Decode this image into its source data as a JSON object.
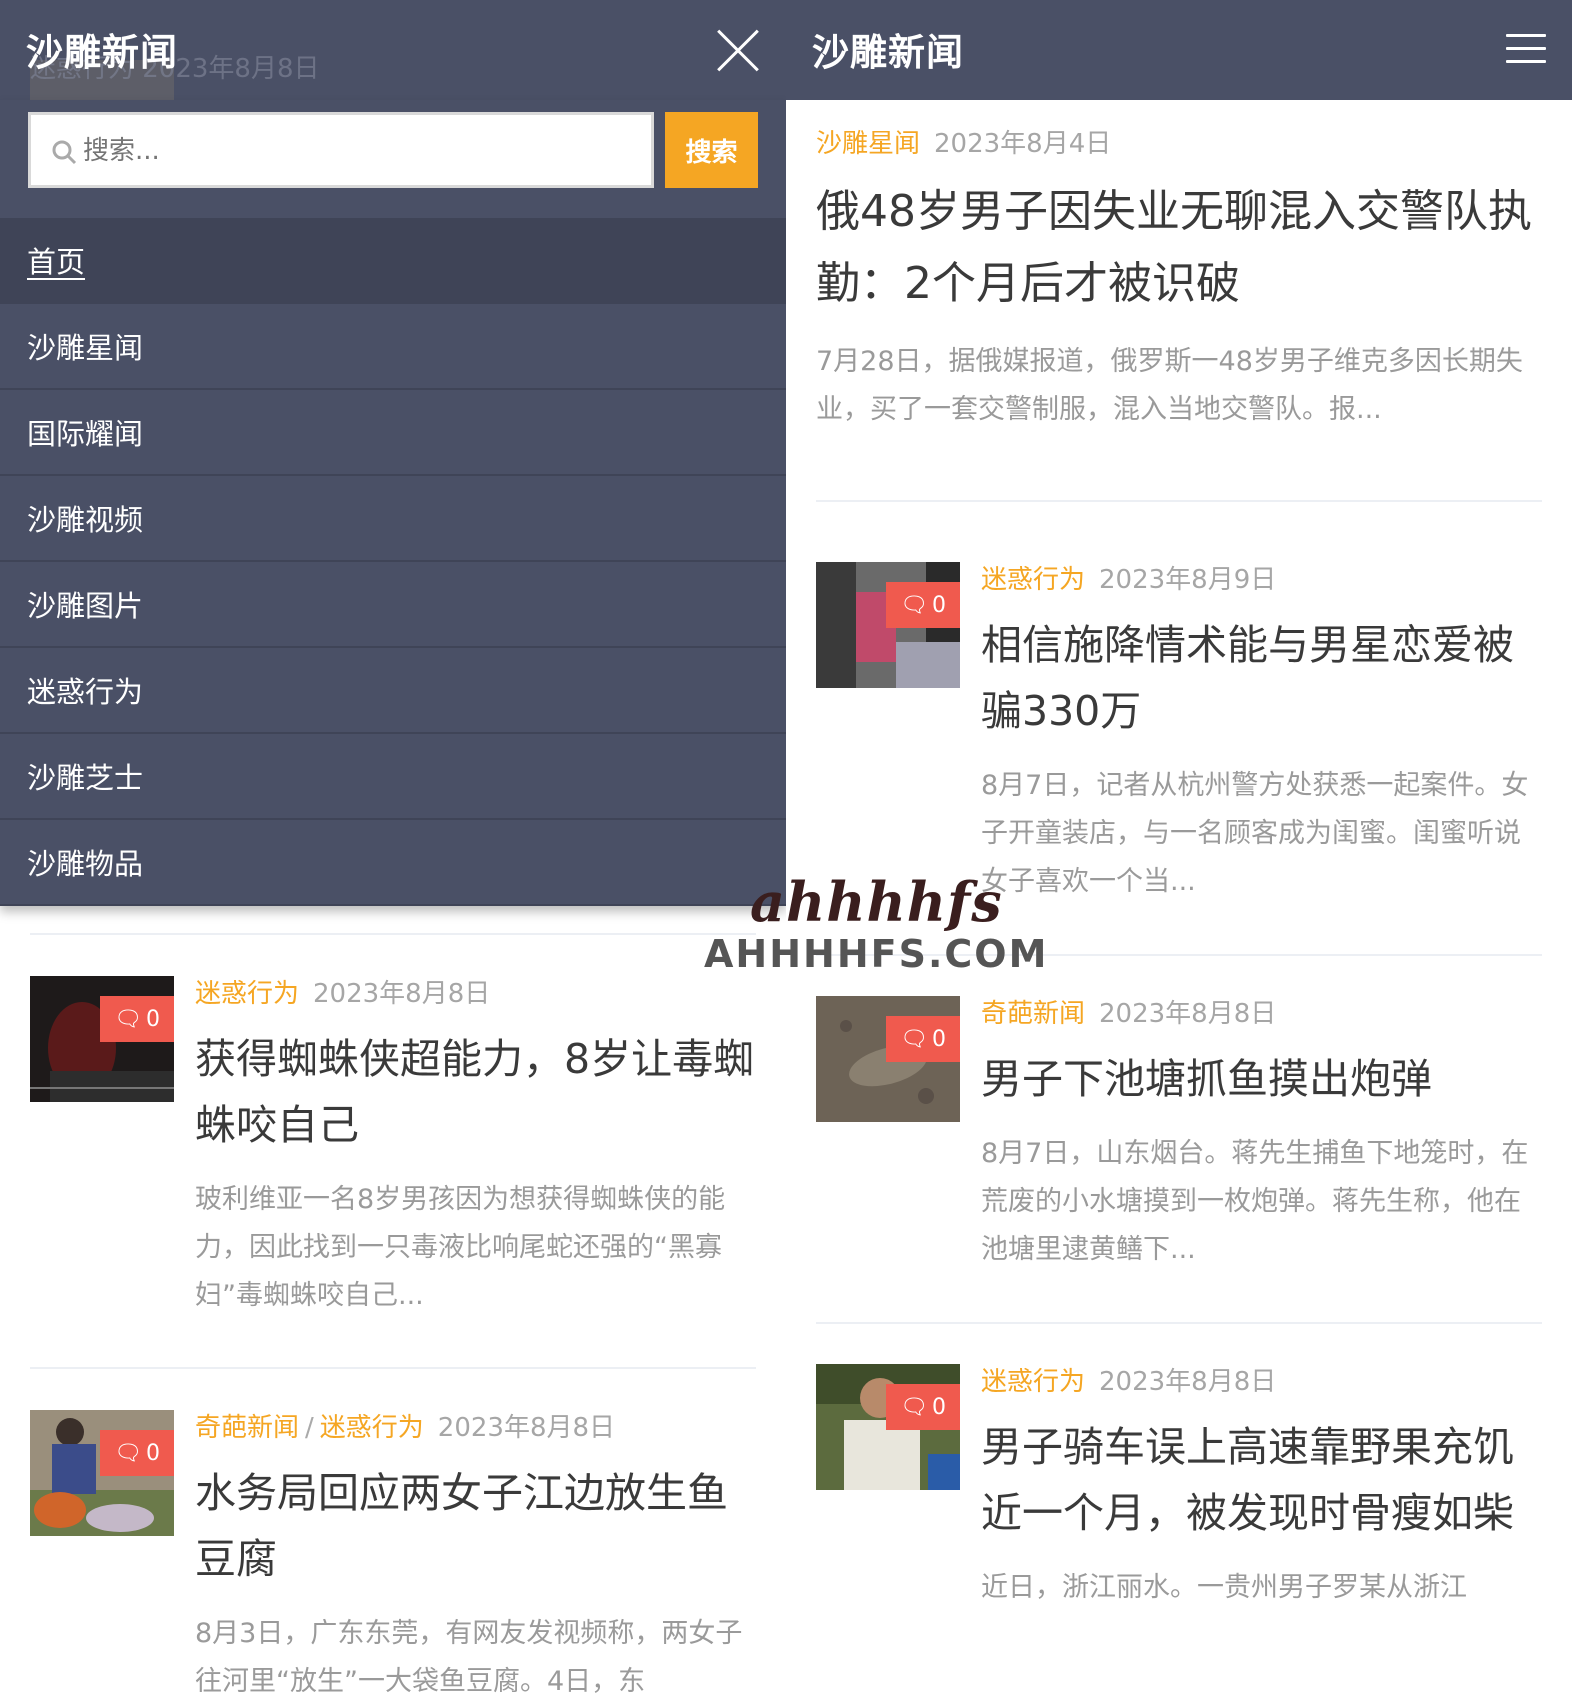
{
  "left": {
    "site_title": "沙雕新闻",
    "ghost_text": "迷惑行为  2023年8月8日",
    "search": {
      "placeholder": "搜索...",
      "button": "搜索"
    },
    "nav": [
      "首页",
      "沙雕星闻",
      "国际耀闻",
      "沙雕视频",
      "沙雕图片",
      "迷惑行为",
      "沙雕芝士",
      "沙雕物品"
    ],
    "articles": [
      {
        "categories": [
          "迷惑行为"
        ],
        "date": "2023年8月8日",
        "comments": "0",
        "title": "获得蜘蛛侠超能力，8岁让毒蜘蛛咬自己",
        "excerpt": "玻利维亚一名8岁男孩因为想获得蜘蛛侠的能力，因此找到一只毒液比响尾蛇还强的“黑寡妇”毒蜘蛛咬自己..."
      },
      {
        "categories": [
          "奇葩新闻",
          "迷惑行为"
        ],
        "category_separator": "/",
        "date": "2023年8月8日",
        "comments": "0",
        "title": "水务局回应两女子江边放生鱼豆腐",
        "excerpt": "8月3日，广东东莞，有网友发视频称，两女子往河里“放生”一大袋鱼豆腐。4日，东"
      }
    ]
  },
  "right": {
    "site_title": "沙雕新闻",
    "articles": [
      {
        "categories": [
          "沙雕星闻"
        ],
        "date": "2023年8月4日",
        "title": "俄48岁男子因失业无聊混入交警队执勤：2个月后才被识破",
        "excerpt": "7月28日，据俄媒报道，俄罗斯一48岁男子维克多因长期失业，买了一套交警制服，混入当地交警队。报..."
      },
      {
        "categories": [
          "迷惑行为"
        ],
        "date": "2023年8月9日",
        "comments": "0",
        "title": "相信施降情术能与男星恋爱被骗330万",
        "excerpt": "8月7日，记者从杭州警方处获悉一起案件。女子开童装店，与一名顾客成为闺蜜。闺蜜听说女子喜欢一个当..."
      },
      {
        "categories": [
          "奇葩新闻"
        ],
        "date": "2023年8月8日",
        "comments": "0",
        "title": "男子下池塘抓鱼摸出炮弹",
        "excerpt": "8月7日，山东烟台。蒋先生捕鱼下地笼时，在荒废的小水塘摸到一枚炮弹。蒋先生称，他在池塘里逮黄鳝下..."
      },
      {
        "categories": [
          "迷惑行为"
        ],
        "date": "2023年8月8日",
        "comments": "0",
        "title": "男子骑车误上高速靠野果充饥近一个月，被发现时骨瘦如柴",
        "excerpt": "近日，浙江丽水。一贵州男子罗某从浙江"
      }
    ]
  },
  "watermark": {
    "script": "ahhhhfs",
    "text": "AHHHHFS.COM"
  },
  "colors": {
    "header": "#4a5066",
    "accent": "#f5a623",
    "badge": "#f05a4e"
  }
}
